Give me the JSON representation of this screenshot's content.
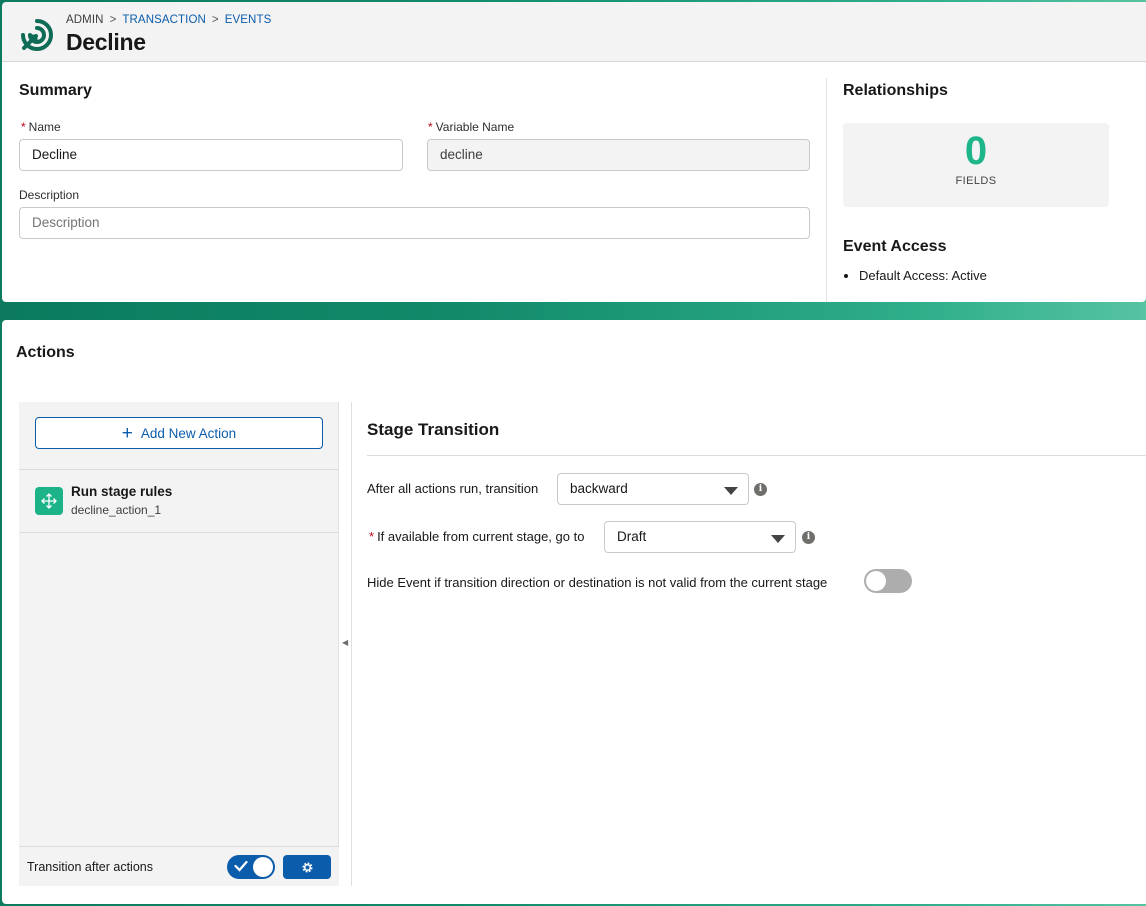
{
  "header": {
    "breadcrumbs": [
      "ADMIN",
      "TRANSACTION",
      "EVENTS"
    ],
    "title": "Decline"
  },
  "summary": {
    "heading": "Summary",
    "name_label": "Name",
    "name_value": "Decline",
    "variable_label": "Variable Name",
    "variable_value": "decline",
    "description_label": "Description",
    "description_placeholder": "Description"
  },
  "relationships": {
    "heading": "Relationships",
    "count": "0",
    "count_label": "FIELDS"
  },
  "event_access": {
    "heading": "Event Access",
    "items": [
      "Default Access: Active"
    ]
  },
  "actions": {
    "heading": "Actions",
    "add_button": "Add New Action",
    "items": [
      {
        "title": "Run stage rules",
        "subtitle": "decline_action_1"
      }
    ],
    "footer_label": "Transition after actions",
    "transition_toggle_on": true
  },
  "stage_transition": {
    "heading": "Stage Transition",
    "direction_label": "After all actions run, transition",
    "direction_value": "backward",
    "destination_label": "If available from current stage, go to",
    "destination_value": "Draft",
    "hide_label": "Hide Event if transition direction or destination is not valid from the current stage",
    "hide_toggle_on": false
  },
  "colors": {
    "accent_blue": "#0b5cab",
    "accent_green": "#1fb58a",
    "required_red": "#ba0517"
  }
}
